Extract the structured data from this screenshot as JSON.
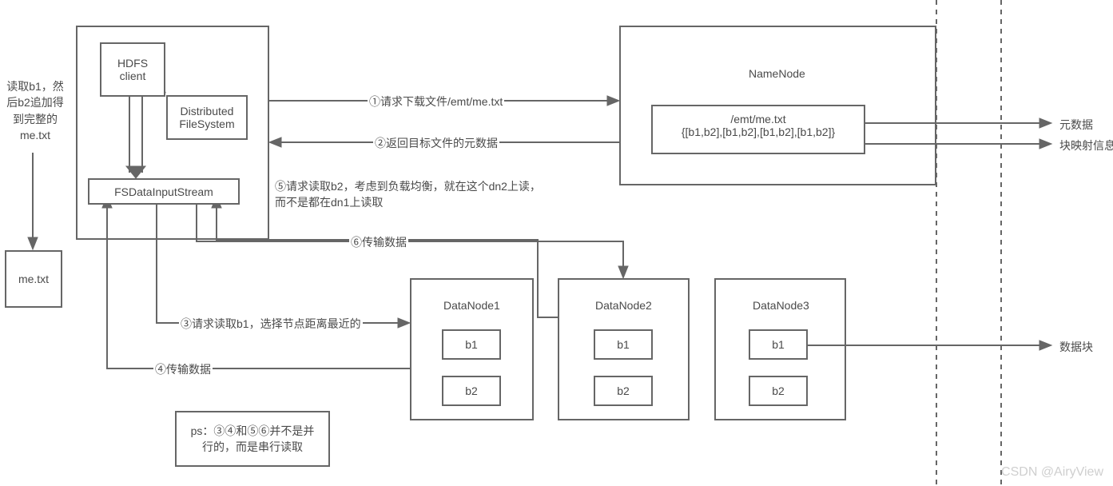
{
  "hdfs_client": "HDFS\nclient",
  "distributed_fs": "Distributed\nFileSystem",
  "fsdis": "FSDataInputStream",
  "namenode": "NameNode",
  "namenode_file": "/emt/me.txt",
  "namenode_blocks": "{[b1,b2],[b1,b2],[b1,b2],[b1,b2]}",
  "me_txt": "me.txt",
  "read_text": "读取b1，然\n后b2追加得\n到完整的\nme.txt",
  "side_meta": "元数据",
  "side_blockmap": "块映射信息",
  "side_datablock": "数据块",
  "datanode1": "DataNode1",
  "datanode2": "DataNode2",
  "datanode3": "DataNode3",
  "b1": "b1",
  "b2": "b2",
  "step1": "①请求下载文件/emt/me.txt",
  "step2": "②返回目标文件的元数据",
  "step3": "③请求读取b1，选择节点距离最近的",
  "step4": "④传输数据",
  "step5": "⑤请求读取b2，考虑到负载均衡，就在这个dn2上读，\n而不是都在dn1上读取",
  "step6": "⑥传输数据",
  "ps_note": "ps：③④和⑤⑥并不是并\n行的，而是串行读取",
  "watermark": "CSDN @AiryView"
}
